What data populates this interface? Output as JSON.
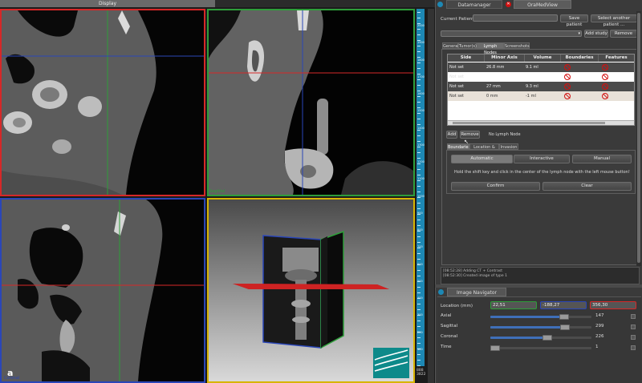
{
  "display": {
    "title": "Display",
    "panel_letter": "a",
    "sagittal_label": "Sagittal",
    "coronal_label": "Coronal",
    "ruler_numbers": [
      "2000",
      "1900",
      "1800",
      "1700",
      "1600",
      "1500",
      "1400",
      "1300",
      "1200",
      "1100",
      "1000",
      "900",
      "800",
      "700",
      "600",
      "500",
      "400",
      "300",
      "200",
      "100"
    ],
    "readout_1": "888",
    "readout_2": "3822"
  },
  "tabs": {
    "datamanager": "Datamanager",
    "oramodview": "OraMedView"
  },
  "patient": {
    "current_label": "Current Patient:",
    "current_value": "",
    "save_patient": "Save patient",
    "select_another": "Select another patient ...",
    "add_study": "Add study",
    "remove_study": "Remove Stud"
  },
  "subtabs": [
    "General",
    "Tumor(s)",
    "Lymph Nodes",
    "Screenshots"
  ],
  "table": {
    "headers": [
      "Side",
      "Minor Axis",
      "Volume",
      "Boundaries",
      "Features"
    ],
    "rows": [
      {
        "side": "Not set",
        "minor": "26.8 mm",
        "volume": "9.1 ml"
      },
      {
        "side": "Not set",
        "minor": "",
        "volume": ""
      },
      {
        "side": "Not set",
        "minor": "27 mm",
        "volume": "9.3 ml"
      },
      {
        "side": "Not set",
        "minor": "0 mm",
        "volume": "-1 ml"
      }
    ]
  },
  "lymph_actions": {
    "add": "Add",
    "remove": "Remove",
    "status": "No Lymph Node"
  },
  "detail_tabs": [
    "Boundaries",
    "Location & Size",
    "Invasion"
  ],
  "mode_buttons": {
    "automatic": "Automatic",
    "interactive": "Interactive",
    "manual": "Manual"
  },
  "instruction": "Hold the shift key and click in the center of the lymph node with the left mouse button!",
  "confirm": "Confirm",
  "clear": "Clear",
  "log": [
    "[08:52:28] Adding CT + Contrast",
    "[08:52:30] Created image of type 1"
  ],
  "navigator": {
    "title": "Image Navigator",
    "location_label": "Location (mm)",
    "loc_x": "22,51",
    "loc_y": "-188,27",
    "loc_z": "356,30",
    "rows": [
      {
        "label": "Axial",
        "value": "147",
        "fraction": 0.73
      },
      {
        "label": "Sagittal",
        "value": "299",
        "fraction": 0.74
      },
      {
        "label": "Coronal",
        "value": "226",
        "fraction": 0.56
      },
      {
        "label": "Time",
        "value": "1",
        "fraction": 0.05
      }
    ]
  },
  "colors": {
    "axial": "#d62828",
    "sagittal": "#2e9e3a",
    "coronal": "#2a46b8",
    "threed": "#d8b400",
    "ruler": "#1d88b4"
  }
}
